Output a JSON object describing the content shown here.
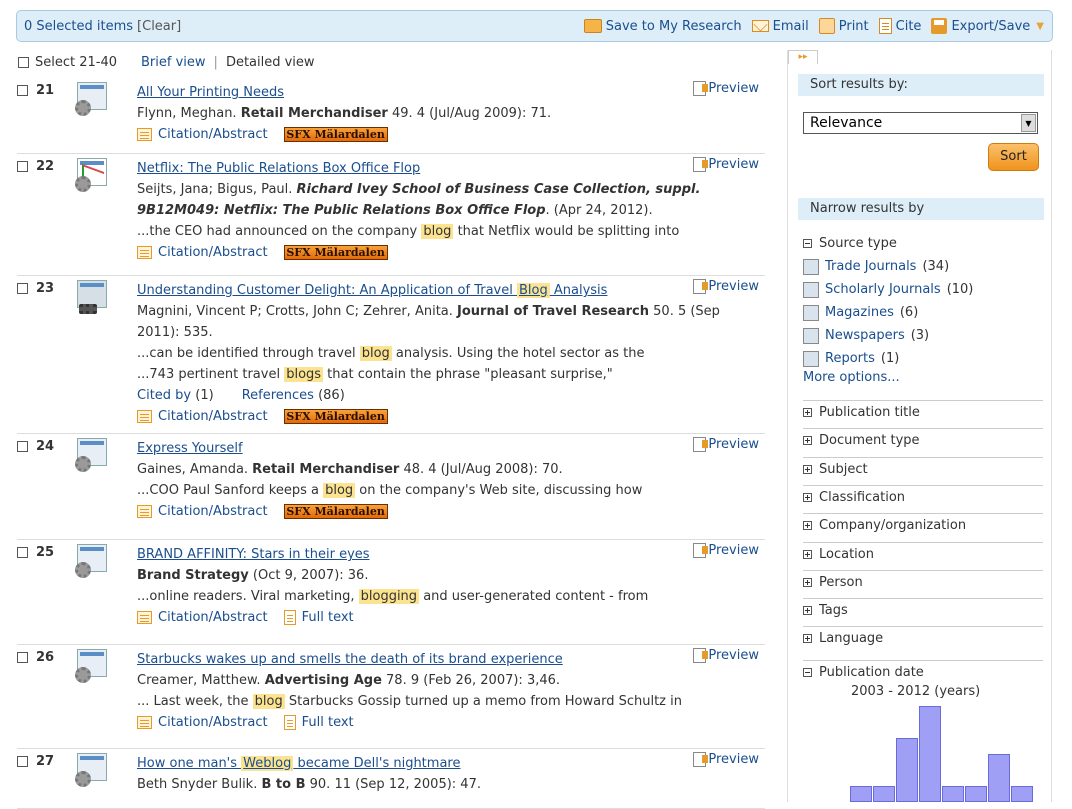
{
  "topbar": {
    "selected": "0 Selected items",
    "clear": "[Clear]",
    "actions": [
      "Save to My Research",
      "Email",
      "Print",
      "Cite",
      "Export/Save"
    ]
  },
  "list_header": {
    "select_range": "Select 21-40",
    "brief_view": "Brief view",
    "sep": "|",
    "detailed_view": "Detailed view"
  },
  "results": [
    {
      "num": "21",
      "title": "All Your Printing Needs",
      "meta_html": "Flynn, Meghan. <b>Retail Merchandiser</b> 49. 4  (Jul/Aug 2009): 71.",
      "snippet_html": "",
      "cited": "",
      "links": [
        "Citation/Abstract",
        "SFX"
      ]
    },
    {
      "num": "22",
      "title": "Netflix: The Public Relations Box Office Flop",
      "meta_html": " Seijts, Jana; Bigus, Paul. <b><i>Richard Ivey School of Business Case Collection, suppl. 9B12M049: Netflix: The Public Relations Box Office Flop</i></b>. (Apr 24, 2012).",
      "snippet_html": "...the CEO had announced on the company <span class='hl'>blog</span> that Netflix would be splitting into",
      "cited": "",
      "links": [
        "Citation/Abstract",
        "SFX"
      ]
    },
    {
      "num": "23",
      "title_html": "Understanding Customer Delight: An Application of Travel <span class='hl'>Blog</span> Analysis",
      "meta_html": "Magnini, Vincent P; Crotts, John C; Zehrer, Anita. <b>Journal of Travel Research</b> 50. 5 (Sep 2011): 535.",
      "snippet_html": "...can be identified through travel <span class='hl'>blog</span> analysis. Using the hotel sector as the<br>...743 pertinent travel <span class='hl'>blogs</span> that contain the phrase \"pleasant surprise,\"",
      "cited": "yes",
      "links": [
        "Citation/Abstract",
        "SFX"
      ]
    },
    {
      "num": "24",
      "title": "Express Yourself",
      "meta_html": "Gaines, Amanda. <b>Retail Merchandiser</b> 48. 4  (Jul/Aug 2008): 70.",
      "snippet_html": "...COO Paul Sanford keeps a <span class='hl'>blog</span> on the company's Web site, discussing how",
      "cited": "",
      "links": [
        "Citation/Abstract",
        "SFX"
      ]
    },
    {
      "num": "25",
      "title": "BRAND AFFINITY: Stars in their eyes",
      "meta_html": "<b>Brand Strategy</b> (Oct 9, 2007): 36.",
      "snippet_html": "...online readers. Viral marketing, <span class='hl'>blogging</span> and user-generated content - from",
      "cited": "",
      "links": [
        "Citation/Abstract",
        "Full text"
      ]
    },
    {
      "num": "26",
      "title": "Starbucks wakes up and smells the death of its brand experience",
      "meta_html": "Creamer, Matthew. <b>Advertising Age</b> 78. 9  (Feb 26, 2007): 3,46.",
      "snippet_html": "... Last week, the <span class='hl'>blog</span> Starbucks Gossip turned up a memo from Howard Schultz in",
      "cited": "",
      "links": [
        "Citation/Abstract",
        "Full text"
      ]
    },
    {
      "num": "27",
      "title_html": "How one man's <span class='hl'>Weblog</span> became Dell's nightmare",
      "meta_html": "Beth Snyder Bulik. <b>B to B</b> 90. 11  (Sep 12, 2005): 47.",
      "snippet_html": "",
      "cited": "",
      "links": []
    }
  ],
  "common": {
    "preview": "Preview",
    "citation": "Citation/Abstract",
    "fulltext": "Full text",
    "sfx": "SFX Mälardalen",
    "cited_by": "Cited by",
    "cited_by_count": "(1)",
    "references": "References",
    "references_count": "(86)"
  },
  "sidebar": {
    "tab": "▸▸",
    "sort_header": "Sort results by:",
    "sort_value": "Relevance",
    "sort_button": "Sort",
    "narrow_header": "Narrow results by",
    "source_type": "Source type",
    "sources": [
      {
        "label": "Trade Journals",
        "count": "(34)"
      },
      {
        "label": "Scholarly Journals",
        "count": "(10)"
      },
      {
        "label": "Magazines",
        "count": "(6)"
      },
      {
        "label": "Newspapers",
        "count": "(3)"
      },
      {
        "label": "Reports",
        "count": "(1)"
      }
    ],
    "more_options": "More options...",
    "facets": [
      "Publication title",
      "Document type",
      "Subject",
      "Classification",
      "Company/organization",
      "Location",
      "Person",
      "Tags",
      "Language"
    ],
    "pubdate": "Publication date",
    "years_label": "2003 - 2012 (years)",
    "year_bars": [
      1,
      1,
      4,
      6,
      1,
      1,
      3,
      1
    ]
  }
}
